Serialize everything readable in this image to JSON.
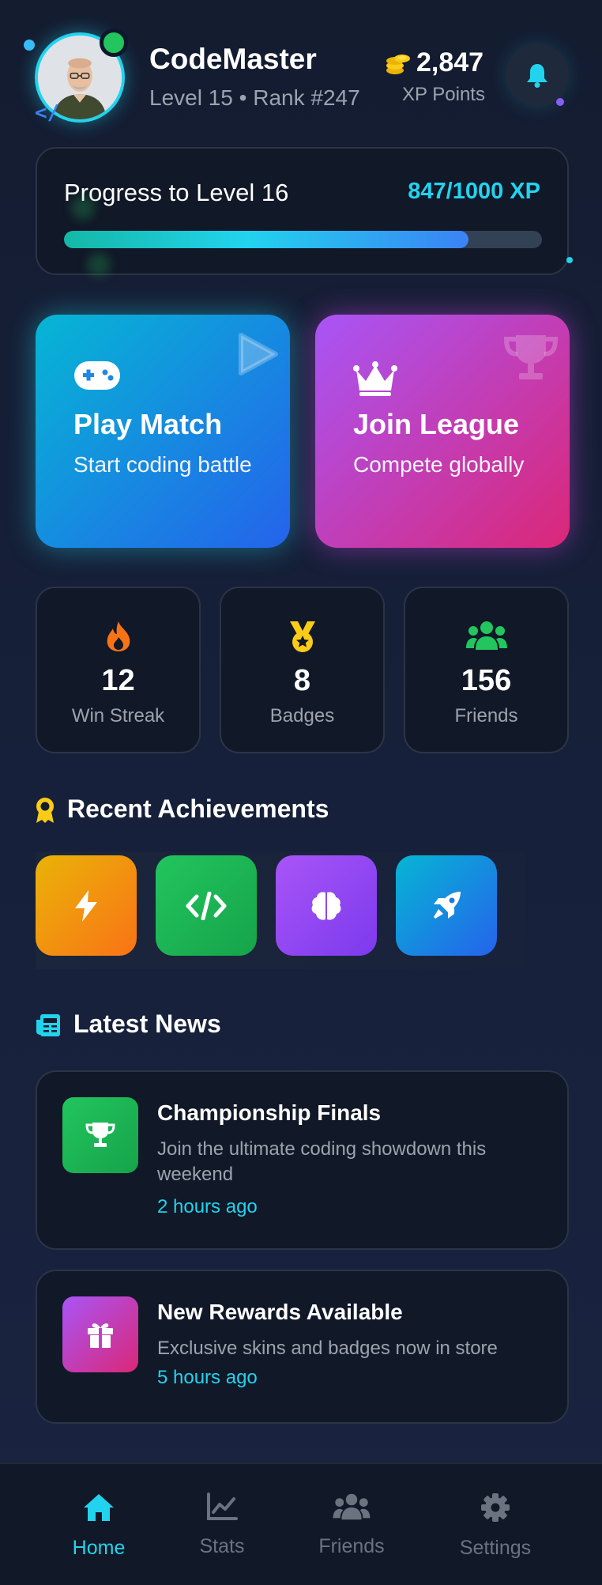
{
  "header": {
    "username": "CodeMaster",
    "level_rank": "Level 15 • Rank #247",
    "xp_value": "2,847",
    "xp_label": "XP Points"
  },
  "progress": {
    "title": "Progress to Level 16",
    "value_text": "847/1000 XP",
    "fraction": 0.847
  },
  "actions": [
    {
      "title": "Play Match",
      "subtitle": "Start coding battle",
      "icon": "gamepad-icon"
    },
    {
      "title": "Join League",
      "subtitle": "Compete globally",
      "icon": "crown-icon"
    }
  ],
  "stats": [
    {
      "value": "12",
      "label": "Win Streak",
      "icon": "fire-icon",
      "color": "#f97316"
    },
    {
      "value": "8",
      "label": "Badges",
      "icon": "medal-icon",
      "color": "#facc15"
    },
    {
      "value": "156",
      "label": "Friends",
      "icon": "users-icon",
      "color": "#22c55e"
    }
  ],
  "achievements": {
    "title": "Recent Achievements",
    "items": [
      {
        "icon": "bolt-icon",
        "colors": [
          "#eab308",
          "#f97316"
        ]
      },
      {
        "icon": "code-icon",
        "colors": [
          "#22c55e",
          "#16a34a"
        ]
      },
      {
        "icon": "brain-icon",
        "colors": [
          "#a855f7",
          "#7c3aed"
        ]
      },
      {
        "icon": "rocket-icon",
        "colors": [
          "#06b6d4",
          "#2563eb"
        ]
      }
    ]
  },
  "news": {
    "title": "Latest News",
    "items": [
      {
        "title": "Championship Finals",
        "description": "Join the ultimate coding showdown this weekend",
        "time": "2 hours ago",
        "icon": "trophy-icon"
      },
      {
        "title": "New Rewards Available",
        "description": "Exclusive skins and badges now in store",
        "time": "5 hours ago",
        "icon": "gift-icon"
      }
    ]
  },
  "nav": [
    {
      "label": "Home",
      "icon": "home-icon",
      "active": true
    },
    {
      "label": "Stats",
      "icon": "chart-icon",
      "active": false
    },
    {
      "label": "Friends",
      "icon": "friends-icon",
      "active": false
    },
    {
      "label": "Settings",
      "icon": "gear-icon",
      "active": false
    }
  ],
  "colors": {
    "accent": "#22d3ee",
    "background": "#16203a",
    "card": "#111827"
  }
}
